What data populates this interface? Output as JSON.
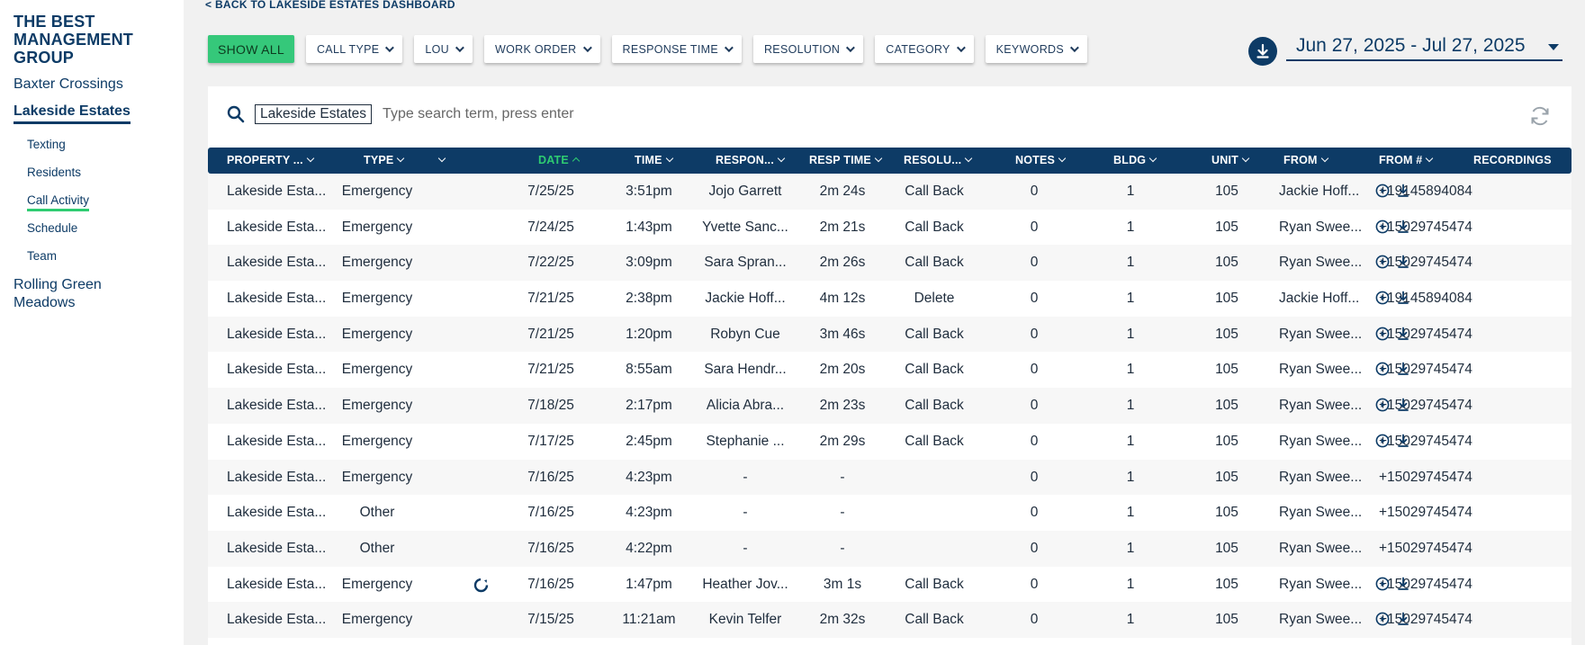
{
  "sidebar": {
    "org_name": "THE BEST MANAGEMENT GROUP",
    "properties": [
      {
        "label": "Baxter Crossings"
      },
      {
        "label": "Lakeside Estates"
      },
      {
        "label": "Rolling Green Meadows"
      }
    ],
    "subnav": [
      {
        "label": "Texting"
      },
      {
        "label": "Residents"
      },
      {
        "label": "Call Activity"
      },
      {
        "label": "Schedule"
      },
      {
        "label": "Team"
      }
    ]
  },
  "back_link": "< BACK TO LAKESIDE ESTATES DASHBOARD",
  "filters": {
    "show_all": "SHOW ALL",
    "items": [
      "CALL TYPE",
      "LOU",
      "WORK ORDER",
      "RESPONSE TIME",
      "RESOLUTION",
      "CATEGORY",
      "KEYWORDS"
    ]
  },
  "date_range": "Jun 27, 2025 - Jul 27, 2025",
  "search": {
    "chip": "Lakeside Estates",
    "placeholder": "Type search term, press enter"
  },
  "table": {
    "columns": [
      "PROPERTY ...",
      "TYPE",
      "",
      "DATE",
      "TIME",
      "RESPON...",
      "RESP TIME",
      "RESOLU...",
      "NOTES",
      "BLDG",
      "UNIT",
      "FROM",
      "FROM #",
      "RECORDINGS"
    ],
    "sorted_column": "DATE",
    "rows": [
      {
        "property": "Lakeside Esta...",
        "type": "Emergency",
        "sync": false,
        "date": "7/25/25",
        "time": "3:51pm",
        "responder": "Jojo Garrett",
        "resp_time": "2m 24s",
        "resolution": "Call Back",
        "notes": "0",
        "bldg": "1",
        "unit": "105",
        "from": "Jackie Hoff...",
        "from_num": "+19145894084",
        "recording": true
      },
      {
        "property": "Lakeside Esta...",
        "type": "Emergency",
        "sync": false,
        "date": "7/24/25",
        "time": "1:43pm",
        "responder": "Yvette Sanc...",
        "resp_time": "2m 21s",
        "resolution": "Call Back",
        "notes": "0",
        "bldg": "1",
        "unit": "105",
        "from": "Ryan Swee...",
        "from_num": "+15029745474",
        "recording": true
      },
      {
        "property": "Lakeside Esta...",
        "type": "Emergency",
        "sync": false,
        "date": "7/22/25",
        "time": "3:09pm",
        "responder": "Sara Spran...",
        "resp_time": "2m 26s",
        "resolution": "Call Back",
        "notes": "0",
        "bldg": "1",
        "unit": "105",
        "from": "Ryan Swee...",
        "from_num": "+15029745474",
        "recording": true
      },
      {
        "property": "Lakeside Esta...",
        "type": "Emergency",
        "sync": false,
        "date": "7/21/25",
        "time": "2:38pm",
        "responder": "Jackie Hoff...",
        "resp_time": "4m 12s",
        "resolution": "Delete",
        "notes": "0",
        "bldg": "1",
        "unit": "105",
        "from": "Jackie Hoff...",
        "from_num": "+19145894084",
        "recording": true
      },
      {
        "property": "Lakeside Esta...",
        "type": "Emergency",
        "sync": false,
        "date": "7/21/25",
        "time": "1:20pm",
        "responder": "Robyn Cue",
        "resp_time": "3m 46s",
        "resolution": "Call Back",
        "notes": "0",
        "bldg": "1",
        "unit": "105",
        "from": "Ryan Swee...",
        "from_num": "+15029745474",
        "recording": true
      },
      {
        "property": "Lakeside Esta...",
        "type": "Emergency",
        "sync": false,
        "date": "7/21/25",
        "time": "8:55am",
        "responder": "Sara Hendr...",
        "resp_time": "2m 20s",
        "resolution": "Call Back",
        "notes": "0",
        "bldg": "1",
        "unit": "105",
        "from": "Ryan Swee...",
        "from_num": "+15029745474",
        "recording": true
      },
      {
        "property": "Lakeside Esta...",
        "type": "Emergency",
        "sync": false,
        "date": "7/18/25",
        "time": "2:17pm",
        "responder": "Alicia Abra...",
        "resp_time": "2m 23s",
        "resolution": "Call Back",
        "notes": "0",
        "bldg": "1",
        "unit": "105",
        "from": "Ryan Swee...",
        "from_num": "+15029745474",
        "recording": true
      },
      {
        "property": "Lakeside Esta...",
        "type": "Emergency",
        "sync": false,
        "date": "7/17/25",
        "time": "2:45pm",
        "responder": "Stephanie ...",
        "resp_time": "2m 29s",
        "resolution": "Call Back",
        "notes": "0",
        "bldg": "1",
        "unit": "105",
        "from": "Ryan Swee...",
        "from_num": "+15029745474",
        "recording": true
      },
      {
        "property": "Lakeside Esta...",
        "type": "Emergency",
        "sync": false,
        "date": "7/16/25",
        "time": "4:23pm",
        "responder": "-",
        "resp_time": "-",
        "resolution": "",
        "notes": "0",
        "bldg": "1",
        "unit": "105",
        "from": "Ryan Swee...",
        "from_num": "+15029745474",
        "recording": false
      },
      {
        "property": "Lakeside Esta...",
        "type": "Other",
        "sync": false,
        "date": "7/16/25",
        "time": "4:23pm",
        "responder": "-",
        "resp_time": "-",
        "resolution": "",
        "notes": "0",
        "bldg": "1",
        "unit": "105",
        "from": "Ryan Swee...",
        "from_num": "+15029745474",
        "recording": false
      },
      {
        "property": "Lakeside Esta...",
        "type": "Other",
        "sync": false,
        "date": "7/16/25",
        "time": "4:22pm",
        "responder": "-",
        "resp_time": "-",
        "resolution": "",
        "notes": "0",
        "bldg": "1",
        "unit": "105",
        "from": "Ryan Swee...",
        "from_num": "+15029745474",
        "recording": false
      },
      {
        "property": "Lakeside Esta...",
        "type": "Emergency",
        "sync": true,
        "date": "7/16/25",
        "time": "1:47pm",
        "responder": "Heather Jov...",
        "resp_time": "3m 1s",
        "resolution": "Call Back",
        "notes": "0",
        "bldg": "1",
        "unit": "105",
        "from": "Ryan Swee...",
        "from_num": "+15029745474",
        "recording": true
      },
      {
        "property": "Lakeside Esta...",
        "type": "Emergency",
        "sync": false,
        "date": "7/15/25",
        "time": "11:21am",
        "responder": "Kevin Telfer",
        "resp_time": "2m 32s",
        "resolution": "Call Back",
        "notes": "0",
        "bldg": "1",
        "unit": "105",
        "from": "Ryan Swee...",
        "from_num": "+15029745474",
        "recording": true
      }
    ]
  },
  "colors": {
    "navy": "#0d3b66",
    "green": "#35c87a",
    "sorted_header": "#2ecc71",
    "row_alt": "#f7f7f7"
  },
  "icons": [
    "download-icon",
    "search-icon",
    "refresh-icon",
    "play-icon",
    "sync-icon"
  ]
}
